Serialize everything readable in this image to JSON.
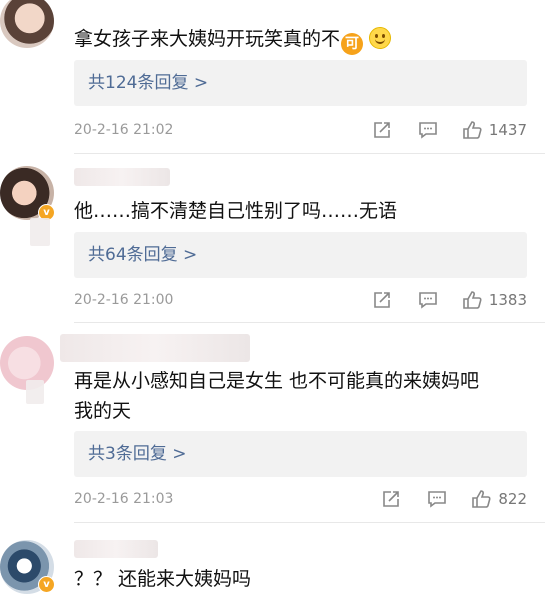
{
  "comments": [
    {
      "text": "拿女孩子来大姨妈开玩笑真的不",
      "emoji_ke": "可",
      "replies": "共124条回复 >",
      "time": "20-2-16 21:02",
      "likes": "1437"
    },
    {
      "text": "他……搞不清楚自己性别了吗……无语",
      "replies": "共64条回复 >",
      "time": "20-2-16 21:00",
      "likes": "1383"
    },
    {
      "text_line1": "再是从小感知自己是女生  也不可能真的来姨妈吧",
      "text_line2": "我的天",
      "replies": "共3条回复 >",
      "time": "20-2-16 21:03",
      "likes": "822"
    },
    {
      "text": "？？ 还能来大姨妈吗"
    }
  ],
  "badge_label": "v",
  "icons": {
    "share": "share-icon",
    "comment": "comment-icon",
    "like": "thumbs-up-icon",
    "verified": "verified-badge-icon",
    "emoji_smile": "smile-emoji-icon"
  },
  "colors": {
    "reply_link": "#4f6b95",
    "reply_bg": "#f2f2f2",
    "meta_text": "#9a9a9a",
    "badge": "#f5a623"
  }
}
